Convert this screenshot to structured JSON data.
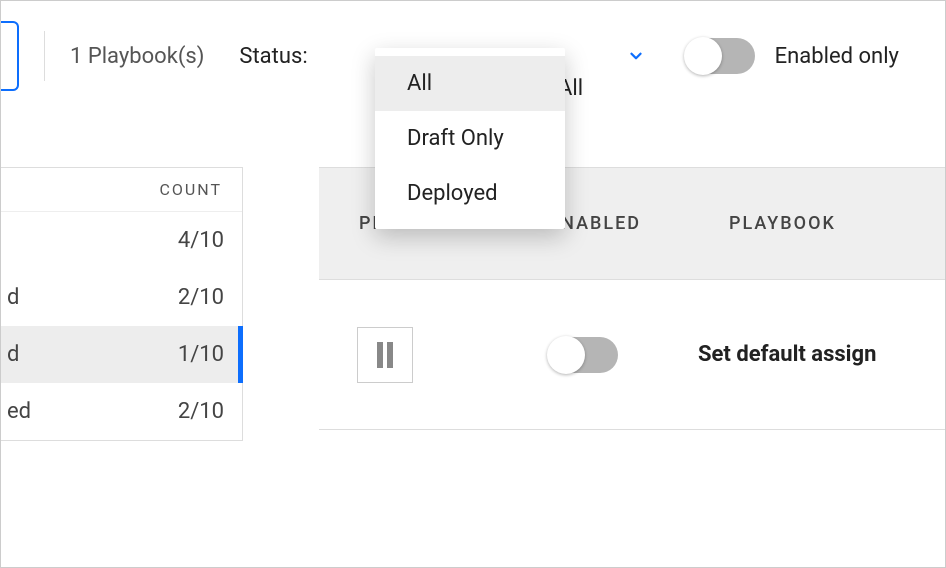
{
  "toolbar": {
    "count_label": "1 Playbook(s)",
    "status_label": "Status:",
    "status_value": "All",
    "enabled_only_label": "Enabled only"
  },
  "status_dropdown": {
    "options": [
      "All",
      "Draft Only",
      "Deployed"
    ],
    "selected": "All"
  },
  "sidebar": {
    "header": "COUNT",
    "rows": [
      {
        "label": "",
        "count": "4/10",
        "active": false
      },
      {
        "label": "d",
        "count": "2/10",
        "active": false
      },
      {
        "label": "d",
        "count": "1/10",
        "active": true
      },
      {
        "label": "ed",
        "count": "2/10",
        "active": false
      }
    ]
  },
  "table": {
    "headers": {
      "priority": "PRIORITY",
      "enabled": "ENABLED",
      "playbook": "PLAYBOOK"
    },
    "rows": [
      {
        "playbook": "Set default assign",
        "enabled": false
      }
    ]
  }
}
